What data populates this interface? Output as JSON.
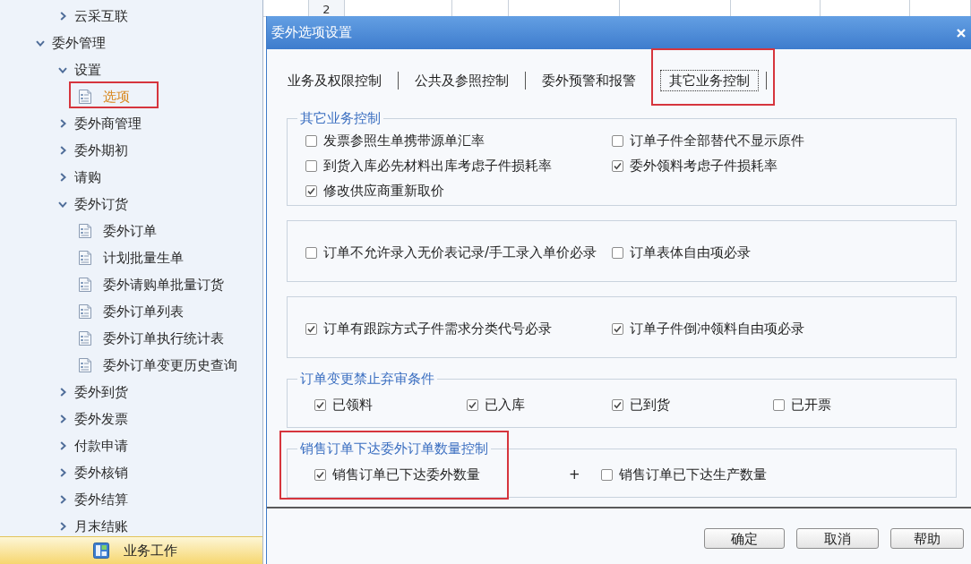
{
  "background_table": {
    "row_number": "2"
  },
  "sidebar": {
    "continued_items": [
      {
        "label": "云采互联",
        "kind": "folder",
        "expanded": false,
        "selected": false,
        "highlighted": false
      }
    ],
    "items": [
      {
        "label": "委外管理",
        "kind": "folder",
        "expanded": true,
        "selected": false,
        "highlighted": false,
        "children": [
          {
            "label": "设置",
            "kind": "folder",
            "expanded": true,
            "selected": false,
            "highlighted": false,
            "children": [
              {
                "label": "选项",
                "kind": "page",
                "selected": true,
                "highlighted": true
              }
            ]
          },
          {
            "label": "委外商管理",
            "kind": "folder",
            "expanded": false,
            "selected": false,
            "highlighted": false
          },
          {
            "label": "委外期初",
            "kind": "folder",
            "expanded": false,
            "selected": false,
            "highlighted": false
          },
          {
            "label": "请购",
            "kind": "folder",
            "expanded": false,
            "selected": false,
            "highlighted": false
          },
          {
            "label": "委外订货",
            "kind": "folder",
            "expanded": true,
            "selected": false,
            "highlighted": false,
            "children": [
              {
                "label": "委外订单",
                "kind": "page",
                "selected": false,
                "highlighted": false
              },
              {
                "label": "计划批量生单",
                "kind": "page",
                "selected": false,
                "highlighted": false
              },
              {
                "label": "委外请购单批量订货",
                "kind": "page",
                "selected": false,
                "highlighted": false
              },
              {
                "label": "委外订单列表",
                "kind": "page",
                "selected": false,
                "highlighted": false
              },
              {
                "label": "委外订单执行统计表",
                "kind": "page",
                "selected": false,
                "highlighted": false
              },
              {
                "label": "委外订单变更历史查询",
                "kind": "page",
                "selected": false,
                "highlighted": false
              }
            ]
          },
          {
            "label": "委外到货",
            "kind": "folder",
            "expanded": false,
            "selected": false,
            "highlighted": false
          },
          {
            "label": "委外发票",
            "kind": "folder",
            "expanded": false,
            "selected": false,
            "highlighted": false
          },
          {
            "label": "付款申请",
            "kind": "folder",
            "expanded": false,
            "selected": false,
            "highlighted": false
          },
          {
            "label": "委外核销",
            "kind": "folder",
            "expanded": false,
            "selected": false,
            "highlighted": false
          },
          {
            "label": "委外结算",
            "kind": "folder",
            "expanded": false,
            "selected": false,
            "highlighted": false
          },
          {
            "label": "月末结账",
            "kind": "folder",
            "expanded": false,
            "selected": false,
            "highlighted": false
          }
        ]
      }
    ],
    "bottom_bar": {
      "label": "业务工作"
    }
  },
  "dialog": {
    "title": "委外选项设置",
    "tabs": [
      {
        "label": "业务及权限控制",
        "selected": false,
        "highlighted": false
      },
      {
        "label": "公共及参照控制",
        "selected": false,
        "highlighted": false
      },
      {
        "label": "委外预警和报警",
        "selected": false,
        "highlighted": false
      },
      {
        "label": "其它业务控制",
        "selected": true,
        "highlighted": true
      }
    ],
    "groups": [
      {
        "legend": "其它业务控制",
        "kind": "twocol",
        "highlighted": false,
        "options": [
          {
            "label": "发票参照生单携带源单汇率",
            "checked": false
          },
          {
            "label": "订单子件全部替代不显示原件",
            "checked": false
          },
          {
            "label": "到货入库必先材料出库考虑子件损耗率",
            "checked": false
          },
          {
            "label": "委外领料考虑子件损耗率",
            "checked": true
          },
          {
            "label": "修改供应商重新取价",
            "checked": true
          }
        ]
      },
      {
        "kind": "twocol",
        "highlighted": false,
        "options": [
          {
            "label": "订单不允许录入无价表记录/手工录入单价必录",
            "checked": false
          },
          {
            "label": "订单表体自由项必录",
            "checked": false
          }
        ]
      },
      {
        "kind": "twocol",
        "highlighted": false,
        "options": [
          {
            "label": "订单有跟踪方式子件需求分类代号必录",
            "checked": true
          },
          {
            "label": "订单子件倒冲领料自由项必录",
            "checked": true
          }
        ]
      },
      {
        "legend": "订单变更禁止弃审条件",
        "kind": "fourcol",
        "highlighted": false,
        "options": [
          {
            "label": "已领料",
            "checked": true
          },
          {
            "label": "已入库",
            "checked": true
          },
          {
            "label": "已到货",
            "checked": true
          },
          {
            "label": "已开票",
            "checked": false
          }
        ]
      },
      {
        "legend": "销售订单下达委外订单数量控制",
        "kind": "sum",
        "highlighted": true,
        "joiner": "+",
        "options": [
          {
            "label": "销售订单已下达委外数量",
            "checked": true
          },
          {
            "label": "销售订单已下达生产数量",
            "checked": false
          }
        ]
      }
    ],
    "buttons": [
      "确定",
      "取消",
      "帮助"
    ]
  }
}
